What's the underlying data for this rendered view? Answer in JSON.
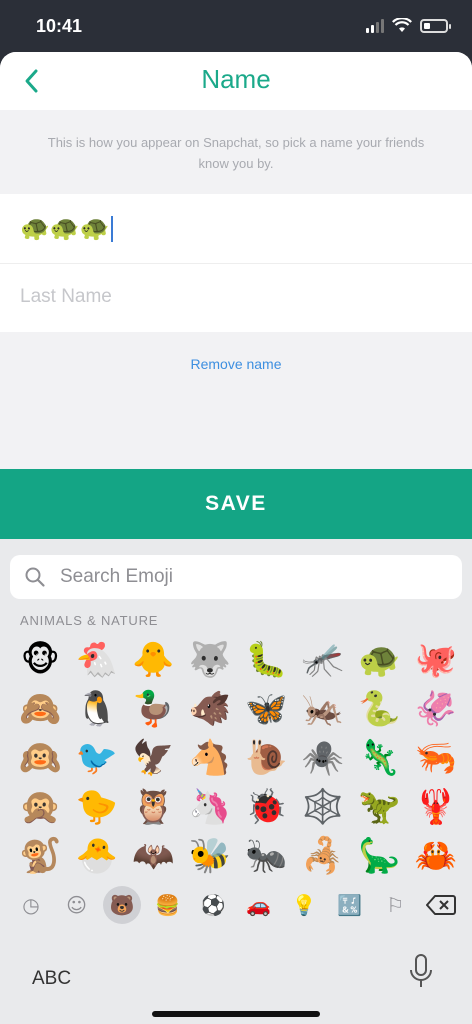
{
  "status_bar": {
    "time": "10:41"
  },
  "nav": {
    "title": "Name",
    "back_icon": "chevron-left-icon"
  },
  "hint": "This is how you appear on Snapchat, so pick a name your friends know you by.",
  "form": {
    "first_name_value": "🐢🐢🐢",
    "last_name_placeholder": "Last Name"
  },
  "remove_name_label": "Remove name",
  "save_label": "SAVE",
  "colors": {
    "accent": "#14a585",
    "title": "#1ba98a",
    "link": "#3d8fe0"
  },
  "keyboard": {
    "search_placeholder": "Search Emoji",
    "category_label": "ANIMALS & NATURE",
    "emojis": [
      "🐵",
      "🐔",
      "🐥",
      "🐺",
      "🐛",
      "🦟",
      "🐢",
      "🐙",
      "🙈",
      "🐧",
      "🦆",
      "🐗",
      "🦋",
      "🦗",
      "🐍",
      "🦑",
      "🙉",
      "🐦",
      "🦅",
      "🐴",
      "🐌",
      "🕷️",
      "🦎",
      "🦐",
      "🙊",
      "🐤",
      "🦉",
      "🦄",
      "🐞",
      "🕸️",
      "🦖",
      "🦞",
      "🐒",
      "🐣",
      "🦇",
      "🐝",
      "🐜",
      "🦂",
      "🦕",
      "🦀"
    ],
    "categories": [
      {
        "name": "recent-icon",
        "glyph": "◷"
      },
      {
        "name": "smileys-icon",
        "glyph": "☺"
      },
      {
        "name": "animals-icon",
        "glyph": "🐻",
        "active": true
      },
      {
        "name": "food-icon",
        "glyph": "🍔"
      },
      {
        "name": "activity-icon",
        "glyph": "⚽"
      },
      {
        "name": "travel-icon",
        "glyph": "🚗"
      },
      {
        "name": "objects-icon",
        "glyph": "💡"
      },
      {
        "name": "symbols-icon",
        "glyph": "🔣"
      },
      {
        "name": "flags-icon",
        "glyph": "⚐"
      }
    ],
    "abc_label": "ABC"
  }
}
